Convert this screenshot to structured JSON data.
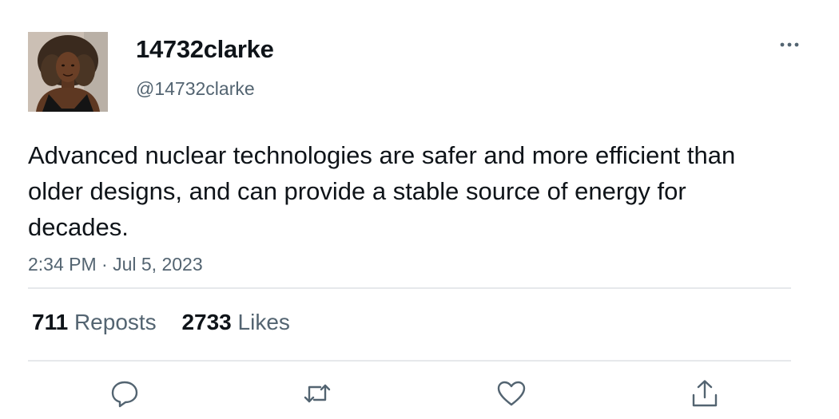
{
  "user": {
    "display_name": "14732clarke",
    "handle": "@14732clarke"
  },
  "tweet": {
    "text": "Advanced nuclear technologies are safer and more efficient than older designs, and can provide a stable source of energy for decades.",
    "timestamp": "2:34 PM · Jul 5, 2023"
  },
  "stats": {
    "reposts_count": "711",
    "reposts_label": "Reposts",
    "likes_count": "2733",
    "likes_label": "Likes"
  },
  "actions": [
    {
      "icon": "reply-icon"
    },
    {
      "icon": "repost-icon"
    },
    {
      "icon": "like-icon"
    },
    {
      "icon": "share-icon"
    }
  ],
  "colors": {
    "text_primary": "#0f1419",
    "text_secondary": "#536471",
    "divider": "#e6e8eb"
  }
}
